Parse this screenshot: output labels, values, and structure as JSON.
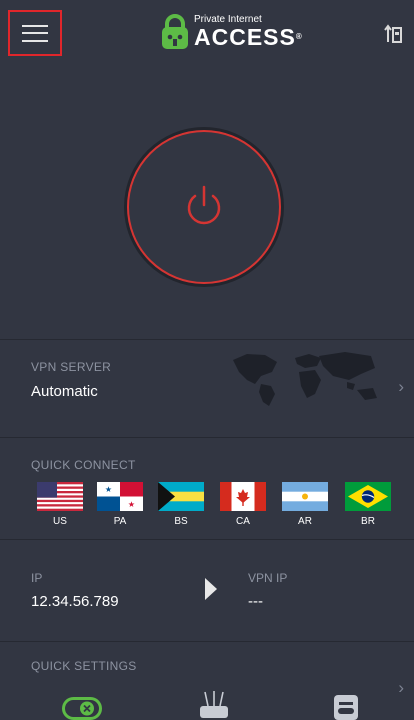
{
  "header": {
    "logo_small": "Private Internet",
    "logo_big": "ACCESS",
    "menu_icon": "hamburger-menu-icon",
    "switch_icon": "switch-arrows-icon"
  },
  "power": {
    "state": "disconnected",
    "ring_color": "#d53533"
  },
  "vpn_server": {
    "label": "VPN SERVER",
    "value": "Automatic"
  },
  "quick_connect": {
    "label": "QUICK CONNECT",
    "countries": [
      "US",
      "PA",
      "BS",
      "CA",
      "AR",
      "BR"
    ]
  },
  "ip": {
    "ip_label": "IP",
    "ip_value": "12.34.56.789",
    "vpn_ip_label": "VPN IP",
    "vpn_ip_value": "---"
  },
  "quick_settings": {
    "label": "QUICK SETTINGS",
    "icons": [
      "killswitch-toggle-icon",
      "network-router-icon",
      "private-browser-icon"
    ]
  },
  "colors": {
    "background": "#323642",
    "accent": "#d53533",
    "green": "#5dbb46"
  }
}
